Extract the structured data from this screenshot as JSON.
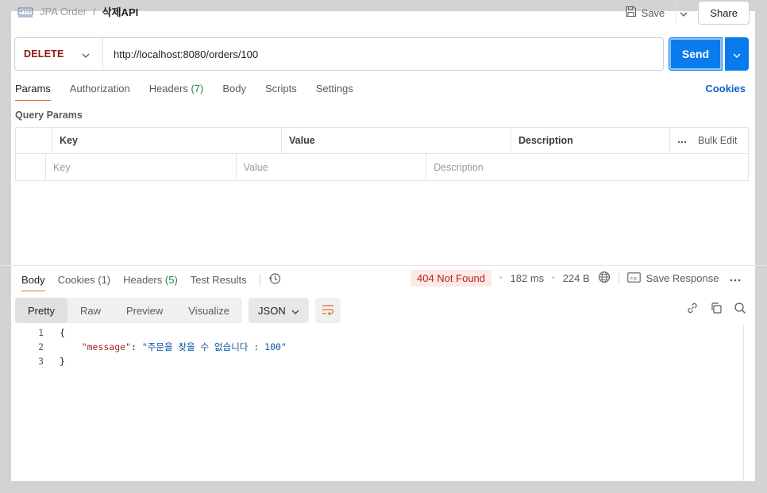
{
  "breadcrumb": {
    "parent": "JPA Order",
    "separator": "/",
    "current": "삭제API"
  },
  "top_actions": {
    "save_label": "Save",
    "share_label": "Share"
  },
  "request": {
    "method": "DELETE",
    "url": "http://localhost:8080/orders/100",
    "send_label": "Send"
  },
  "request_tabs": [
    {
      "label": "Params",
      "count": "",
      "active": true
    },
    {
      "label": "Authorization",
      "count": "",
      "active": false
    },
    {
      "label": "Headers",
      "count": "(7)",
      "active": false
    },
    {
      "label": "Body",
      "count": "",
      "active": false
    },
    {
      "label": "Scripts",
      "count": "",
      "active": false
    },
    {
      "label": "Settings",
      "count": "",
      "active": false
    }
  ],
  "cookies_label": "Cookies",
  "query_params": {
    "title": "Query Params",
    "headers": {
      "key": "Key",
      "value": "Value",
      "description": "Description",
      "bulk_edit": "Bulk Edit"
    },
    "placeholders": {
      "key": "Key",
      "value": "Value",
      "description": "Description"
    }
  },
  "response_tabs": [
    {
      "label": "Body",
      "count": "",
      "active": true
    },
    {
      "label": "Cookies",
      "count": "(1)",
      "active": false
    },
    {
      "label": "Headers",
      "count": "(5)",
      "active": false
    },
    {
      "label": "Test Results",
      "count": "",
      "active": false
    }
  ],
  "response_meta": {
    "status": "404 Not Found",
    "time": "182 ms",
    "size": "224 B",
    "save_response_label": "Save Response"
  },
  "format_bar": {
    "modes": [
      "Pretty",
      "Raw",
      "Preview",
      "Visualize"
    ],
    "active_mode": "Pretty",
    "language": "JSON"
  },
  "code_lines": [
    {
      "num": "1",
      "text": "{"
    },
    {
      "num": "2",
      "key": "\"message\"",
      "colon": ": ",
      "value": "\"주문을 찾을 수 없습니다 : 100\""
    },
    {
      "num": "3",
      "text": "}"
    }
  ],
  "colors": {
    "send": "#097bed",
    "method": "#8e1a10",
    "status_bg": "#fde9e6",
    "status_fg": "#b3261e",
    "accent_tab": "#e36e38",
    "link": "#0a63c7"
  },
  "icons": [
    "http-icon",
    "save-icon",
    "chevron-down-icon",
    "history-icon",
    "globe-icon",
    "save-response-icon",
    "more-icon",
    "wrap-icon",
    "link-icon",
    "copy-icon",
    "search-icon"
  ]
}
